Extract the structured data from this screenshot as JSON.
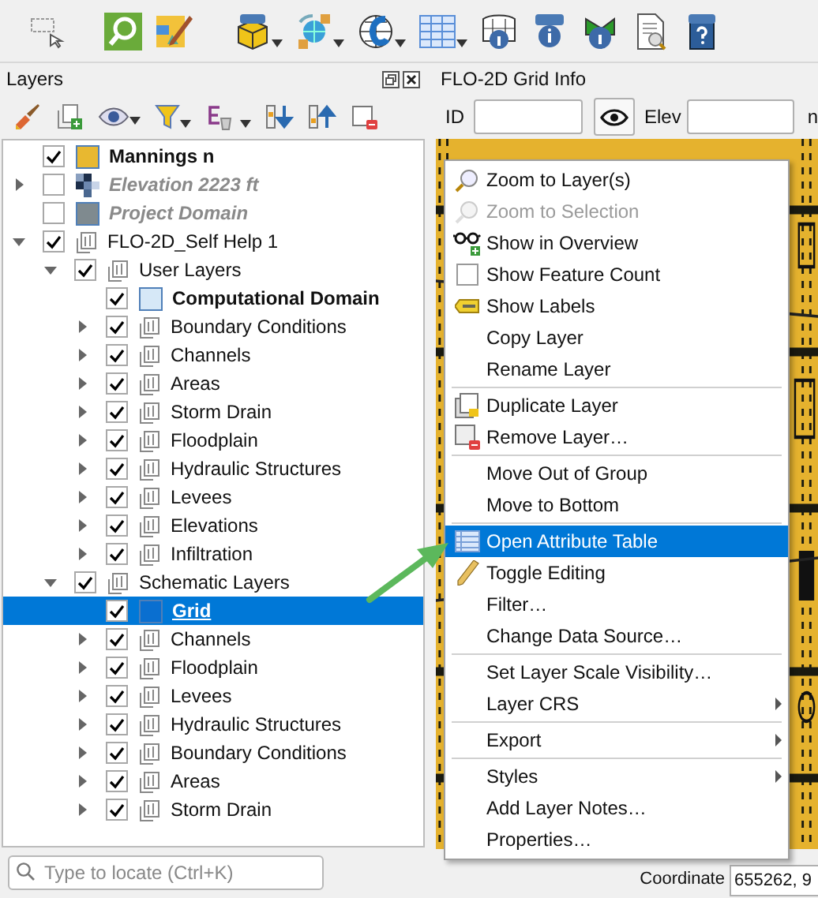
{
  "layers_panel": {
    "title": "Layers",
    "items": [
      {
        "label": "Mannings n",
        "kind": "fill",
        "color": "#e8b830",
        "checked": true,
        "selected": false,
        "bold": true,
        "italic": false
      },
      {
        "label": "Elevation 2223 ft",
        "kind": "raster",
        "checked": false,
        "expanded": false,
        "selected": false,
        "bold": true,
        "italic": true
      },
      {
        "label": "Project Domain",
        "kind": "fill",
        "color": "#7f8a8f",
        "checked": false,
        "selected": false,
        "bold": true,
        "italic": true
      },
      {
        "label": "FLO-2D_Self Help 1",
        "kind": "group",
        "checked": true,
        "expanded": true,
        "selected": false,
        "bold": false,
        "italic": false,
        "children": [
          {
            "label": "User Layers",
            "kind": "group",
            "checked": true,
            "expanded": true,
            "selected": false,
            "bold": false,
            "italic": false,
            "children": [
              {
                "label": "Computational Domain",
                "kind": "fill",
                "color": "#d6e8f7",
                "checked": true,
                "selected": false,
                "bold": true,
                "italic": false
              },
              {
                "label": "Boundary Conditions",
                "kind": "group",
                "checked": true,
                "expanded": false,
                "selected": false,
                "bold": false,
                "italic": false
              },
              {
                "label": "Channels",
                "kind": "group",
                "checked": true,
                "expanded": false,
                "selected": false,
                "bold": false,
                "italic": false
              },
              {
                "label": "Areas",
                "kind": "group",
                "checked": true,
                "expanded": false,
                "selected": false,
                "bold": false,
                "italic": false
              },
              {
                "label": "Storm Drain",
                "kind": "group",
                "checked": true,
                "expanded": false,
                "selected": false,
                "bold": false,
                "italic": false
              },
              {
                "label": "Floodplain",
                "kind": "group",
                "checked": true,
                "expanded": false,
                "selected": false,
                "bold": false,
                "italic": false
              },
              {
                "label": "Hydraulic Structures",
                "kind": "group",
                "checked": true,
                "expanded": false,
                "selected": false,
                "bold": false,
                "italic": false
              },
              {
                "label": "Levees",
                "kind": "group",
                "checked": true,
                "expanded": false,
                "selected": false,
                "bold": false,
                "italic": false
              },
              {
                "label": "Elevations",
                "kind": "group",
                "checked": true,
                "expanded": false,
                "selected": false,
                "bold": false,
                "italic": false
              },
              {
                "label": "Infiltration",
                "kind": "group",
                "checked": true,
                "expanded": false,
                "selected": false,
                "bold": false,
                "italic": false
              }
            ]
          },
          {
            "label": "Schematic Layers",
            "kind": "group",
            "checked": true,
            "expanded": true,
            "selected": false,
            "bold": false,
            "italic": false,
            "children": [
              {
                "label": "Grid",
                "kind": "fill",
                "color": "#0a6fd0",
                "checked": true,
                "selected": true,
                "bold": true,
                "italic": false
              },
              {
                "label": "Channels",
                "kind": "group",
                "checked": true,
                "expanded": false,
                "selected": false,
                "bold": false,
                "italic": false
              },
              {
                "label": "Floodplain",
                "kind": "group",
                "checked": true,
                "expanded": false,
                "selected": false,
                "bold": false,
                "italic": false
              },
              {
                "label": "Levees",
                "kind": "group",
                "checked": true,
                "expanded": false,
                "selected": false,
                "bold": false,
                "italic": false
              },
              {
                "label": "Hydraulic Structures",
                "kind": "group",
                "checked": true,
                "expanded": false,
                "selected": false,
                "bold": false,
                "italic": false
              },
              {
                "label": "Boundary Conditions",
                "kind": "group",
                "checked": true,
                "expanded": false,
                "selected": false,
                "bold": false,
                "italic": false
              },
              {
                "label": "Areas",
                "kind": "group",
                "checked": true,
                "expanded": false,
                "selected": false,
                "bold": false,
                "italic": false
              },
              {
                "label": "Storm Drain",
                "kind": "group",
                "checked": true,
                "expanded": false,
                "selected": false,
                "bold": false,
                "italic": false
              }
            ]
          }
        ]
      }
    ],
    "search": {
      "placeholder": "Type to locate (Ctrl+K)"
    }
  },
  "grid_info_panel": {
    "title": "FLO-2D Grid Info",
    "id_label": "ID",
    "elev_label": "Elev",
    "column_3_label": "n"
  },
  "context_menu": {
    "sections": [
      [
        {
          "label": "Zoom to Layer(s)",
          "kind": "action",
          "disabled": false,
          "selected": false,
          "submenu": false
        },
        {
          "label": "Zoom to Selection",
          "kind": "action",
          "disabled": true,
          "selected": false,
          "submenu": false
        },
        {
          "label": "Show in Overview",
          "kind": "action",
          "disabled": false,
          "selected": false,
          "submenu": false
        },
        {
          "label": "Show Feature Count",
          "kind": "checkbox",
          "checked": false,
          "disabled": false,
          "selected": false,
          "submenu": false
        },
        {
          "label": "Show Labels",
          "kind": "action",
          "disabled": false,
          "selected": false,
          "submenu": false
        },
        {
          "label": "Copy Layer",
          "kind": "action",
          "disabled": false,
          "selected": false,
          "submenu": false
        },
        {
          "label": "Rename Layer",
          "kind": "action",
          "disabled": false,
          "selected": false,
          "submenu": false
        }
      ],
      [
        {
          "label": "Duplicate Layer",
          "kind": "action",
          "disabled": false,
          "selected": false,
          "submenu": false
        },
        {
          "label": "Remove Layer…",
          "kind": "action",
          "disabled": false,
          "selected": false,
          "submenu": false
        }
      ],
      [
        {
          "label": "Move Out of Group",
          "kind": "action",
          "disabled": false,
          "selected": false,
          "submenu": false
        },
        {
          "label": "Move to Bottom",
          "kind": "action",
          "disabled": false,
          "selected": false,
          "submenu": false
        }
      ],
      [
        {
          "label": "Open Attribute Table",
          "kind": "action",
          "disabled": false,
          "selected": true,
          "submenu": false
        },
        {
          "label": "Toggle Editing",
          "kind": "action",
          "disabled": false,
          "selected": false,
          "submenu": false
        },
        {
          "label": "Filter…",
          "kind": "action",
          "disabled": false,
          "selected": false,
          "submenu": false
        },
        {
          "label": "Change Data Source…",
          "kind": "action",
          "disabled": false,
          "selected": false,
          "submenu": false
        }
      ],
      [
        {
          "label": "Set Layer Scale Visibility…",
          "kind": "action",
          "disabled": false,
          "selected": false,
          "submenu": false
        },
        {
          "label": "Layer CRS",
          "kind": "action",
          "disabled": false,
          "selected": false,
          "submenu": true
        }
      ],
      [
        {
          "label": "Export",
          "kind": "action",
          "disabled": false,
          "selected": false,
          "submenu": true
        }
      ],
      [
        {
          "label": "Styles",
          "kind": "action",
          "disabled": false,
          "selected": false,
          "submenu": true
        },
        {
          "label": "Add Layer Notes…",
          "kind": "action",
          "disabled": false,
          "selected": false,
          "submenu": false
        },
        {
          "label": "Properties…",
          "kind": "action",
          "disabled": false,
          "selected": false,
          "submenu": false
        }
      ]
    ]
  },
  "status_bar": {
    "coordinate_label": "Coordinate",
    "coordinate_value": "655262, 9"
  }
}
